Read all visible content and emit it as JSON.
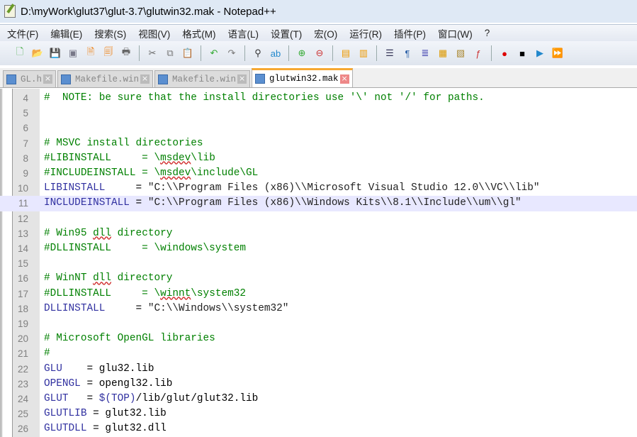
{
  "window": {
    "title": "D:\\myWork\\glut37\\glut-3.7\\glutwin32.mak - Notepad++"
  },
  "menu": [
    "文件(F)",
    "编辑(E)",
    "搜索(S)",
    "视图(V)",
    "格式(M)",
    "语言(L)",
    "设置(T)",
    "宏(O)",
    "运行(R)",
    "插件(P)",
    "窗口(W)",
    "?"
  ],
  "toolbar": [
    {
      "icon": "new-file-icon",
      "g": "🗋",
      "c": "#4a4"
    },
    {
      "icon": "open-file-icon",
      "g": "📂",
      "c": "#d9a020"
    },
    {
      "icon": "save-icon",
      "g": "💾",
      "c": "#778"
    },
    {
      "icon": "save-all-icon",
      "g": "▣",
      "c": "#778"
    },
    {
      "icon": "close-icon",
      "g": "🗎",
      "c": "#e70"
    },
    {
      "icon": "close-all-icon",
      "g": "🗐",
      "c": "#e70"
    },
    {
      "icon": "print-icon",
      "g": "🖶",
      "c": "#666"
    },
    "sep",
    {
      "icon": "cut-icon",
      "g": "✂",
      "c": "#666"
    },
    {
      "icon": "copy-icon",
      "g": "⧉",
      "c": "#777"
    },
    {
      "icon": "paste-icon",
      "g": "📋",
      "c": "#c90"
    },
    "sep",
    {
      "icon": "undo-icon",
      "g": "↶",
      "c": "#3a3"
    },
    {
      "icon": "redo-icon",
      "g": "↷",
      "c": "#777"
    },
    "sep",
    {
      "icon": "find-icon",
      "g": "⚲",
      "c": "#333"
    },
    {
      "icon": "replace-icon",
      "g": "ab",
      "c": "#28c"
    },
    "sep",
    {
      "icon": "zoom-in-icon",
      "g": "⊕",
      "c": "#3a3"
    },
    {
      "icon": "zoom-out-icon",
      "g": "⊖",
      "c": "#c33"
    },
    "sep",
    {
      "icon": "sync-vertical-icon",
      "g": "▤",
      "c": "#e90"
    },
    {
      "icon": "sync-horizontal-icon",
      "g": "▥",
      "c": "#e90"
    },
    "sep",
    {
      "icon": "word-wrap-icon",
      "g": "☰",
      "c": "#335"
    },
    {
      "icon": "show-all-chars-icon",
      "g": "¶",
      "c": "#36a"
    },
    {
      "icon": "indent-guide-icon",
      "g": "≣",
      "c": "#33a"
    },
    {
      "icon": "user-language-icon",
      "g": "▦",
      "c": "#d90"
    },
    {
      "icon": "doc-map-icon",
      "g": "▧",
      "c": "#a83"
    },
    {
      "icon": "function-list-icon",
      "g": "ƒ",
      "c": "#c33"
    },
    "sep",
    {
      "icon": "record-macro-icon",
      "g": "●",
      "c": "#d00"
    },
    {
      "icon": "stop-record-icon",
      "g": "■",
      "c": "#000"
    },
    {
      "icon": "play-macro-icon",
      "g": "▶",
      "c": "#28c"
    },
    {
      "icon": "run-macro-multiple-icon",
      "g": "⏩",
      "c": "#28c"
    }
  ],
  "tabs": [
    {
      "label": "GL.h",
      "active": false
    },
    {
      "label": "Makefile.win",
      "active": false
    },
    {
      "label": "Makefile.win",
      "active": false
    },
    {
      "label": "glutwin32.mak",
      "active": true
    }
  ],
  "editor": {
    "current_line": 11,
    "lines": [
      {
        "n": "4",
        "parts": [
          {
            "t": "#  NOTE: be sure that the install directories use '\\' not '/' for paths.",
            "k": "comment"
          }
        ]
      },
      {
        "n": "5",
        "parts": []
      },
      {
        "n": "6",
        "parts": []
      },
      {
        "n": "7",
        "parts": [
          {
            "t": "# MSVC install directories",
            "k": "comment"
          }
        ]
      },
      {
        "n": "8",
        "parts": [
          {
            "t": "#LIBINSTALL     = \\",
            "k": "comment"
          },
          {
            "t": "msdev",
            "k": "comment",
            "sq": true
          },
          {
            "t": "\\lib",
            "k": "comment"
          }
        ]
      },
      {
        "n": "9",
        "parts": [
          {
            "t": "#INCLUDEINSTALL = \\",
            "k": "comment"
          },
          {
            "t": "msdev",
            "k": "comment",
            "sq": true
          },
          {
            "t": "\\include\\GL",
            "k": "comment"
          }
        ]
      },
      {
        "n": "10",
        "parts": [
          {
            "t": "LIBINSTALL",
            "k": "var"
          },
          {
            "t": "     = ",
            "k": "op"
          },
          {
            "t": "\"C:\\\\Program Files (x86)\\\\Microsoft Visual Studio 12.0\\\\VC\\\\lib\"",
            "k": "str"
          }
        ]
      },
      {
        "n": "11",
        "parts": [
          {
            "t": "INCLUDEINSTALL",
            "k": "var"
          },
          {
            "t": " = ",
            "k": "op"
          },
          {
            "t": "\"C:\\\\Program Files (x86)\\\\Windows Kits\\\\8.1\\\\Include\\\\um\\\\gl\"",
            "k": "str"
          }
        ]
      },
      {
        "n": "12",
        "parts": []
      },
      {
        "n": "13",
        "parts": [
          {
            "t": "# Win95 ",
            "k": "comment"
          },
          {
            "t": "dll",
            "k": "comment",
            "sq": true
          },
          {
            "t": " directory",
            "k": "comment"
          }
        ]
      },
      {
        "n": "14",
        "parts": [
          {
            "t": "#DLLINSTALL     = \\windows\\system",
            "k": "comment"
          }
        ]
      },
      {
        "n": "15",
        "parts": []
      },
      {
        "n": "16",
        "parts": [
          {
            "t": "# WinNT ",
            "k": "comment"
          },
          {
            "t": "dll",
            "k": "comment",
            "sq": true
          },
          {
            "t": " directory",
            "k": "comment"
          }
        ]
      },
      {
        "n": "17",
        "parts": [
          {
            "t": "#DLLINSTALL     = \\",
            "k": "comment"
          },
          {
            "t": "winnt",
            "k": "comment",
            "sq": true
          },
          {
            "t": "\\system32",
            "k": "comment"
          }
        ]
      },
      {
        "n": "18",
        "parts": [
          {
            "t": "DLLINSTALL",
            "k": "var"
          },
          {
            "t": "     = ",
            "k": "op"
          },
          {
            "t": "\"C:\\\\Windows\\\\system32\"",
            "k": "str"
          }
        ]
      },
      {
        "n": "19",
        "parts": []
      },
      {
        "n": "20",
        "parts": [
          {
            "t": "# Microsoft OpenGL libraries",
            "k": "comment"
          }
        ]
      },
      {
        "n": "21",
        "parts": [
          {
            "t": "#",
            "k": "comment"
          }
        ]
      },
      {
        "n": "22",
        "parts": [
          {
            "t": "GLU",
            "k": "var"
          },
          {
            "t": "    = glu32.lib",
            "k": "op"
          }
        ]
      },
      {
        "n": "23",
        "parts": [
          {
            "t": "OPENGL",
            "k": "var"
          },
          {
            "t": " = opengl32.lib",
            "k": "op"
          }
        ]
      },
      {
        "n": "24",
        "parts": [
          {
            "t": "GLUT",
            "k": "var"
          },
          {
            "t": "   = ",
            "k": "op"
          },
          {
            "t": "$(TOP)",
            "k": "macro"
          },
          {
            "t": "/lib/glut/glut32.lib",
            "k": "op"
          }
        ]
      },
      {
        "n": "25",
        "parts": [
          {
            "t": "GLUTLIB",
            "k": "var"
          },
          {
            "t": " = glut32.lib",
            "k": "op"
          }
        ]
      },
      {
        "n": "26",
        "parts": [
          {
            "t": "GLUTDLL",
            "k": "var"
          },
          {
            "t": " = glut32.dll",
            "k": "op"
          }
        ]
      }
    ]
  }
}
